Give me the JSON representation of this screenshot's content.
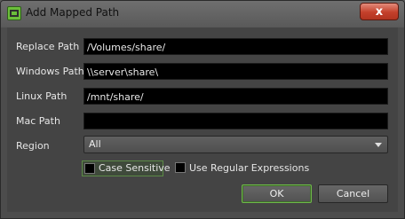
{
  "window": {
    "title": "Add Mapped Path",
    "close_glyph": "x"
  },
  "fields": [
    {
      "label": "Replace Path",
      "value": "/Volumes/share/"
    },
    {
      "label": "Windows Path",
      "value": "\\\\server\\share\\"
    },
    {
      "label": "Linux Path",
      "value": "/mnt/share/"
    },
    {
      "label": "Mac Path",
      "value": ""
    }
  ],
  "region": {
    "label": "Region",
    "selected": "All"
  },
  "options": {
    "case_sensitive": {
      "label": "Case Sensitive",
      "checked": false
    },
    "regex": {
      "label": "Use Regular Expressions",
      "checked": false
    }
  },
  "buttons": {
    "ok": "OK",
    "cancel": "Cancel"
  },
  "colors": {
    "accent_green": "#6fb84a",
    "close_red": "#c4402b"
  },
  "icons": {
    "app": "app-icon",
    "close": "close-icon",
    "dropdown": "chevron-down-icon"
  }
}
